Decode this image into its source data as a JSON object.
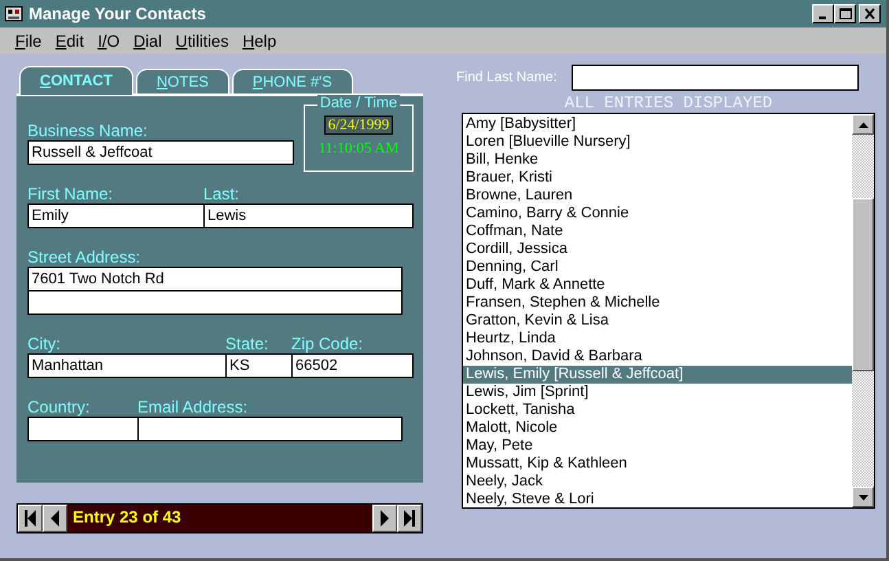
{
  "window": {
    "title": "Manage Your Contacts"
  },
  "menu": [
    "File",
    "Edit",
    "I/O",
    "Dial",
    "Utilities",
    "Help"
  ],
  "tabs": [
    {
      "label": "CONTACT",
      "selected": true
    },
    {
      "label": "NOTES",
      "selected": false
    },
    {
      "label": "PHONE #'S",
      "selected": false
    }
  ],
  "date_time": {
    "label": "Date / Time",
    "date": "6/24/1999",
    "time": "11:10:05 AM"
  },
  "form_rows": [
    {
      "fields": [
        {
          "label": "Business Name:",
          "value": "Russell & Jeffcoat"
        }
      ]
    },
    {
      "fields": [
        {
          "label": "First Name:",
          "value": "Emily"
        },
        {
          "label": "Last:",
          "value": "Lewis"
        }
      ]
    },
    {
      "fields": [
        {
          "label": "Street Address:",
          "value": "7601 Two Notch Rd",
          "kind": "multiline"
        }
      ]
    },
    {
      "fields": [
        {
          "label": "City:",
          "value": "Manhattan"
        },
        {
          "label": "State:",
          "value": "KS"
        },
        {
          "label": "Zip Code:",
          "value": "66502"
        }
      ]
    },
    {
      "fields": [
        {
          "label": "Country:"
        },
        {
          "label": "Email Address:"
        }
      ]
    }
  ],
  "navigator": {
    "text": "Entry 23 of 43"
  },
  "find": {
    "label": "Find Last Name:"
  },
  "list_heading": "ALL ENTRIES DISPLAYED",
  "entries": [
    {
      "name": "Amy [Babysitter]",
      "selected": false
    },
    {
      "name": "Loren [Blueville Nursery]",
      "selected": false
    },
    {
      "name": "Bill, Henke",
      "selected": false
    },
    {
      "name": "Brauer, Kristi",
      "selected": false
    },
    {
      "name": "Browne, Lauren",
      "selected": false
    },
    {
      "name": "Camino, Barry & Connie",
      "selected": false
    },
    {
      "name": "Coffman, Nate",
      "selected": false
    },
    {
      "name": "Cordill, Jessica",
      "selected": false
    },
    {
      "name": "Denning, Carl",
      "selected": false
    },
    {
      "name": "Duff, Mark & Annette",
      "selected": false
    },
    {
      "name": "Fransen, Stephen & Michelle",
      "selected": false
    },
    {
      "name": "Gratton, Kevin & Lisa",
      "selected": false
    },
    {
      "name": "Heurtz, Linda",
      "selected": false
    },
    {
      "name": "Johnson, David & Barbara",
      "selected": false
    },
    {
      "name": "Lewis, Emily [Russell & Jeffcoat]",
      "selected": true
    },
    {
      "name": "Lewis, Jim [Sprint]",
      "selected": false
    },
    {
      "name": "Lockett, Tanisha",
      "selected": false
    },
    {
      "name": "Malott, Nicole",
      "selected": false
    },
    {
      "name": "May, Pete",
      "selected": false
    },
    {
      "name": "Mussatt, Kip & Kathleen",
      "selected": false
    },
    {
      "name": "Neely, Jack",
      "selected": false
    },
    {
      "name": "Neely, Steve & Lori",
      "selected": false
    }
  ]
}
